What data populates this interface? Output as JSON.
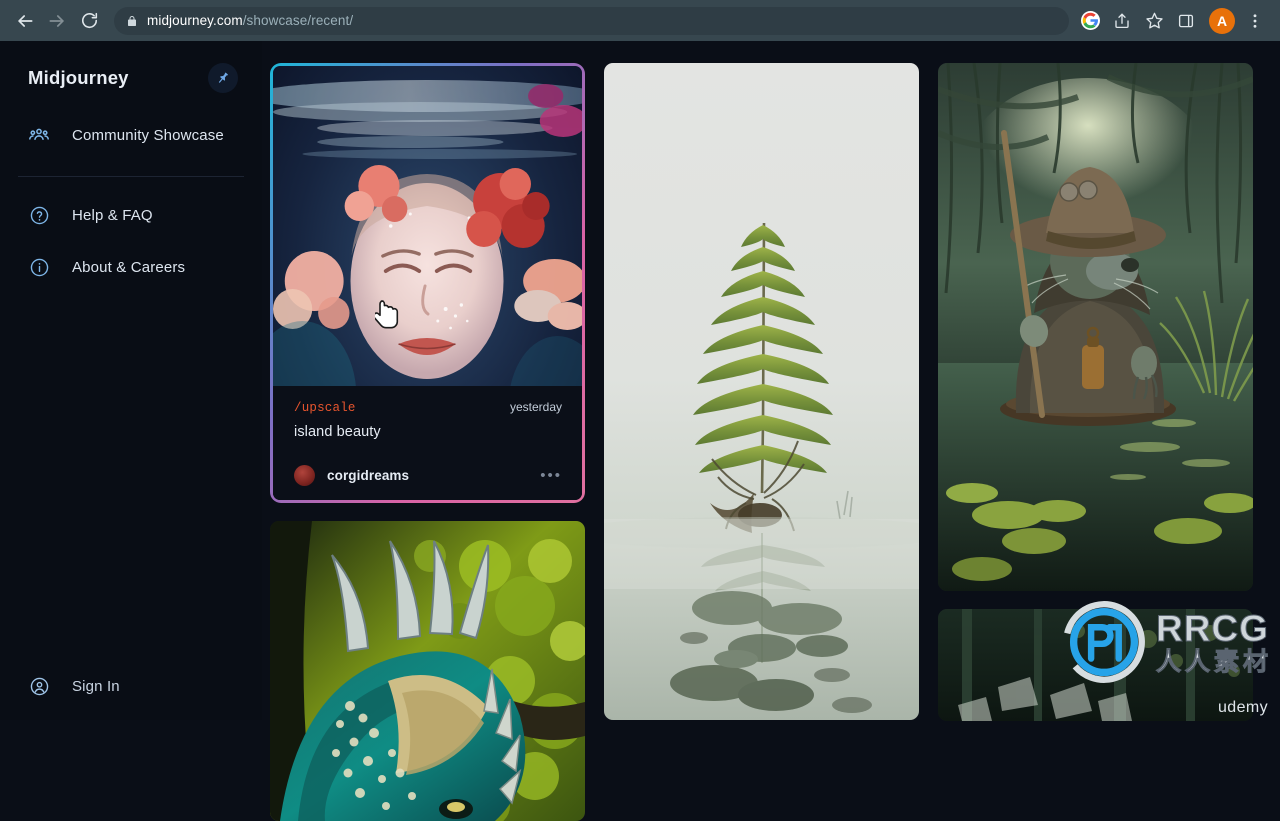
{
  "browser": {
    "back_label": "Back",
    "forward_label": "Forward",
    "reload_label": "Reload",
    "url_domain": "midjourney.com",
    "url_path": "/showcase/recent/",
    "lock_icon": "lock-icon",
    "toolbar_icons": [
      {
        "name": "google-lens-icon",
        "label": "G"
      },
      {
        "name": "share-icon",
        "label": ""
      },
      {
        "name": "bookmark-star-icon",
        "label": ""
      },
      {
        "name": "side-panel-icon",
        "label": ""
      }
    ],
    "profile_initial": "A",
    "menu_label": "Chrome menu"
  },
  "sidebar": {
    "brand": "Midjourney",
    "pin_icon": "pin-icon",
    "primary_items": [
      {
        "label": "Community Showcase",
        "icon": "community-group-icon"
      }
    ],
    "secondary_items": [
      {
        "label": "Help & FAQ",
        "icon": "help-circle-icon"
      },
      {
        "label": "About & Careers",
        "icon": "info-circle-icon"
      }
    ],
    "signin": {
      "label": "Sign In",
      "icon": "user-circle-icon"
    }
  },
  "gallery": {
    "columns": [
      {
        "cards": [
          {
            "alt": "Underwater portrait of a woman surrounded by pink and red flowers",
            "selected": true,
            "meta": {
              "command": "/upscale",
              "time": "yesterday",
              "prompt": "island beauty",
              "author": "corgidreams",
              "more_label": "•••"
            }
          },
          {
            "alt": "Teal and gold horned dragon head amid green foliage",
            "selected": false
          }
        ]
      },
      {
        "cards": [
          {
            "alt": "Single tall fern reflected in misty still water",
            "selected": false
          }
        ]
      },
      {
        "cards": [
          {
            "alt": "Otter creature in a wide hat holding a staff standing in a misty swamp",
            "selected": false
          },
          {
            "alt": "Dark green forest scene with scattered white fragments",
            "selected": false
          }
        ]
      }
    ]
  },
  "watermark": {
    "logo_text": "RRCG",
    "subtitle": "人人素材",
    "provider": "udemy"
  },
  "colors": {
    "browser_bar": "#37474f",
    "page_bg": "#0a0e17",
    "sidebar_bg": "#090d15",
    "accent_command": "#e8552e",
    "profile_chip": "#e8710a"
  }
}
